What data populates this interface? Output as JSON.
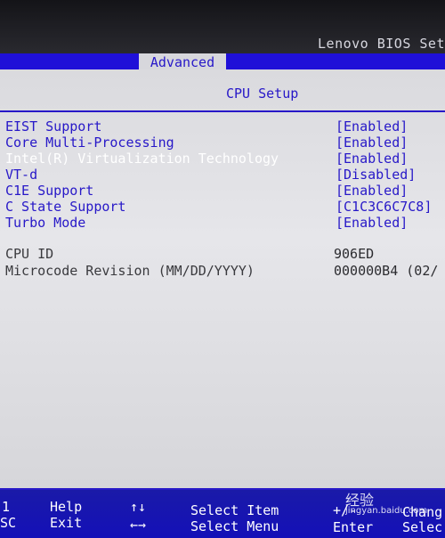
{
  "header": {
    "title": "Lenovo BIOS Set",
    "active_tab": "Advanced"
  },
  "section": {
    "title": "CPU Setup"
  },
  "settings": [
    {
      "label": "EIST Support",
      "value": "[Enabled]"
    },
    {
      "label": "Core Multi-Processing",
      "value": "[Enabled]"
    },
    {
      "label": "Intel(R) Virtualization Technology",
      "value": "[Enabled]"
    },
    {
      "label": "VT-d",
      "value": "[Disabled]"
    },
    {
      "label": "C1E Support",
      "value": "[Enabled]"
    },
    {
      "label": "C State Support",
      "value": "[C1C3C6C7C8]"
    },
    {
      "label": "Turbo Mode",
      "value": "[Enabled]"
    }
  ],
  "info": [
    {
      "label": "CPU ID",
      "value": "906ED"
    },
    {
      "label": "Microcode Revision (MM/DD/YYYY)",
      "value": "000000B4 (02/"
    }
  ],
  "footer": {
    "items": [
      {
        "key": "1",
        "desc": "Help"
      },
      {
        "key": "SC",
        "desc": "Exit"
      },
      {
        "key": "↑↓",
        "desc": "Select Item"
      },
      {
        "key": "←→",
        "desc": "Select Menu"
      },
      {
        "key": "+/-",
        "desc": "Chang"
      },
      {
        "key": "Enter",
        "desc": "Selec"
      }
    ]
  },
  "watermark": {
    "brand": "经验",
    "url": "jingyan.baidu.com"
  },
  "colors": {
    "accent_blue": "#2718c8",
    "tab_bar_blue": "#1f10d8",
    "panel_gray": "#dcdce0",
    "selected_text": "#ffffff"
  }
}
